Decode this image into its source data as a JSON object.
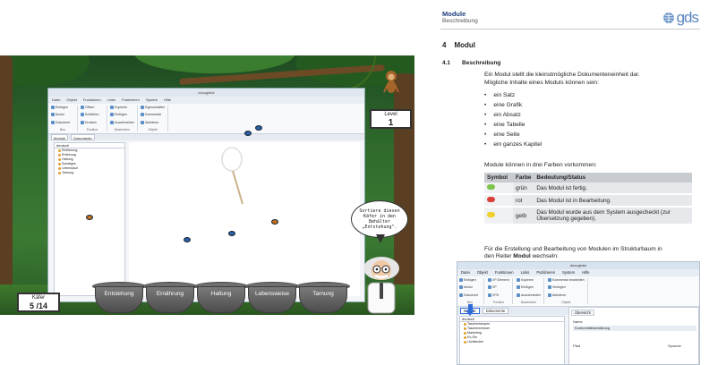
{
  "game": {
    "window_title": "docuglobe",
    "menu": [
      "Datei",
      "Objekt",
      "Funktionen",
      "Links",
      "Publizieren",
      "System",
      "Hilfe"
    ],
    "ribbon_groups": [
      {
        "items": [
          "Einfügen",
          "Modul",
          "Dokument"
        ],
        "label": "Neu"
      },
      {
        "items": [
          "Öffnen",
          "Schließen",
          "Drucken"
        ],
        "label": "Position"
      },
      {
        "items": [
          "Kopieren",
          "Einfügen",
          "Ausschneiden"
        ],
        "label": "Bearbeiten"
      },
      {
        "items": [
          "Eigenschaften",
          "Kommentar",
          "Aktivieren"
        ],
        "label": "Objekt"
      }
    ],
    "tabs": [
      "Module",
      "Dokumente"
    ],
    "select_value": "deutsch",
    "tree": [
      "Einführung",
      "Erfahrung",
      "Haftung",
      "Sonstiges",
      "Lebenslauf",
      "Tarnung"
    ],
    "level_label": "Level",
    "level_value": "1",
    "counter_label": "Käfer",
    "counter_value": "5 /14",
    "speech": "Sortiere diesen Käfer in den Behälter „Entstehung\".",
    "pots": [
      "Entstehung",
      "Ernährung",
      "Haltung",
      "Lebensweise",
      "Tarnung"
    ]
  },
  "doc": {
    "header_title": "Module",
    "header_subtitle": "Beschreibung",
    "logo": "gds",
    "h1_num": "4",
    "h1_text": "Modul",
    "h2_num": "4.1",
    "h2_text": "Beschreibung",
    "intro_1": "Ein Modul stellt die kleinstmögliche Dokumenteneinheit dar.",
    "intro_2": "Mögliche Inhalte eines Moduls können sein:",
    "bullets": [
      "ein Satz",
      "eine Grafik",
      "ein Absatz",
      "eine Tabelle",
      "eine Seite",
      "ein ganzes Kapitel"
    ],
    "colors_intro": "Module können in drei Farben vorkommen:",
    "table": {
      "headers": [
        "Symbol",
        "Farbe",
        "Bedeutung/Status"
      ],
      "rows": [
        {
          "color": "grün",
          "meaning": "Das Modul ist fertig.",
          "sym": "#7cc44a"
        },
        {
          "color": "rot",
          "meaning": "Das Modul ist in Bearbeitung.",
          "sym": "#d9423a"
        },
        {
          "color": "gelb",
          "meaning": "Das Modul wurde aus dem System ausgecheckt (zur Übersetzung gegeben).",
          "sym": "#f0d02a"
        }
      ]
    },
    "outro": "Für die Erstellung und Bearbeitung von Modulen im Strukturbaum in den Reiter Modul wechseln:",
    "outro_before": "Für die Erstellung und Bearbeitung von Modulen im Strukturbaum in",
    "outro_pre_bold": "den Reiter",
    "outro_bold": "Modul",
    "outro_after": "wechseln:",
    "shot": {
      "title": "docuglobe",
      "menu": [
        "Datei",
        "Objekt",
        "Funktionen",
        "Links",
        "Publizieren",
        "System",
        "Hilfe"
      ],
      "ribbon_groups": [
        {
          "items": [
            "Einfügen",
            "Modul",
            "Dokument"
          ],
          "label": "Neu"
        },
        {
          "items": [
            "XP-Element",
            "XP",
            "XPD"
          ],
          "label": "Position"
        },
        {
          "items": [
            "Kopieren",
            "Einfügen",
            "Ausschneiden"
          ],
          "label": "Bearbeiten"
        },
        {
          "items": [
            "Kommentar bearbeiten",
            "Verfolgen",
            "Aktivieren"
          ],
          "label": "Objekt"
        }
      ],
      "tabs": [
        "Module",
        "Dokumente"
      ],
      "select_value": "deutsch",
      "tree": [
        "Taschenlampen",
        "Taschenmesser",
        "Marketing",
        "Ex-Öle",
        "Lichtkeulen"
      ],
      "right_tab": "Übersicht",
      "name_label": "Name",
      "name_value": "Konformitätserklärung",
      "col1": "Pfad",
      "col2": "Sprache"
    }
  },
  "colors": {
    "accent": "#2e6bd8",
    "header_blue": "#1a3a7a",
    "table_head": "#c8cbd0"
  }
}
